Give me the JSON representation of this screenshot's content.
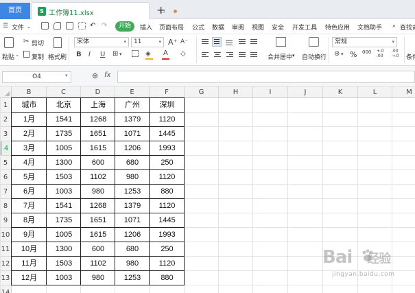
{
  "tabs": {
    "home_label": "首页",
    "file_label": "工作簿11.xlsx"
  },
  "menu": {
    "file_label": "文件",
    "start_label": "开始",
    "items": [
      "插入",
      "页面布局",
      "公式",
      "数据",
      "审阅",
      "视图",
      "安全",
      "开发工具",
      "特色应用",
      "文档助手"
    ],
    "search_label": "查找命"
  },
  "ribbon": {
    "paste_label": "粘贴",
    "cut_label": "剪切",
    "copy_label": "复制",
    "format_painter_label": "格式刷",
    "font_name": "宋体",
    "font_size": "11",
    "merge_label": "合并居中",
    "wrap_label": "自动换行",
    "number_format": "常规",
    "percent_symbol": "%",
    "thousands_symbol": "000",
    "inc_decimal": "+.0 .00",
    "dec_decimal": ".00 →.0",
    "condition_label": "条件"
  },
  "formula_bar": {
    "cell_ref": "O4",
    "fx_label": "fx",
    "formula": ""
  },
  "columns": [
    "B",
    "C",
    "D",
    "E",
    "F",
    "G",
    "H",
    "I",
    "J",
    "K",
    "L",
    "M"
  ],
  "rows": [
    "1",
    "2",
    "3",
    "4",
    "5",
    "6",
    "7",
    "8",
    "9",
    "10",
    "11",
    "12",
    "13",
    "14"
  ],
  "active_row": "4",
  "table": {
    "headers": [
      "城市",
      "北京",
      "上海",
      "广州",
      "深圳"
    ],
    "rows": [
      [
        "1月",
        "1541",
        "1268",
        "1379",
        "1120"
      ],
      [
        "2月",
        "1735",
        "1651",
        "1071",
        "1445"
      ],
      [
        "3月",
        "1005",
        "1615",
        "1206",
        "1993"
      ],
      [
        "4月",
        "1300",
        "600",
        "680",
        "250"
      ],
      [
        "5月",
        "1503",
        "1102",
        "980",
        "1120"
      ],
      [
        "6月",
        "1003",
        "980",
        "1253",
        "880"
      ],
      [
        "7月",
        "1541",
        "1268",
        "1379",
        "1120"
      ],
      [
        "8月",
        "1735",
        "1651",
        "1071",
        "1445"
      ],
      [
        "9月",
        "1005",
        "1615",
        "1206",
        "1993"
      ],
      [
        "10月",
        "1300",
        "600",
        "680",
        "250"
      ],
      [
        "11月",
        "1503",
        "1102",
        "980",
        "1120"
      ],
      [
        "12月",
        "1003",
        "980",
        "1253",
        "880"
      ]
    ]
  },
  "watermark": {
    "logo": "Bai",
    "logo_suffix": "经验",
    "sub": "jingyan.baidu.com"
  },
  "colors": {
    "accent_green": "#1f9e55",
    "home_tab": "#3d86e4",
    "start_button": "#3faa5a"
  }
}
